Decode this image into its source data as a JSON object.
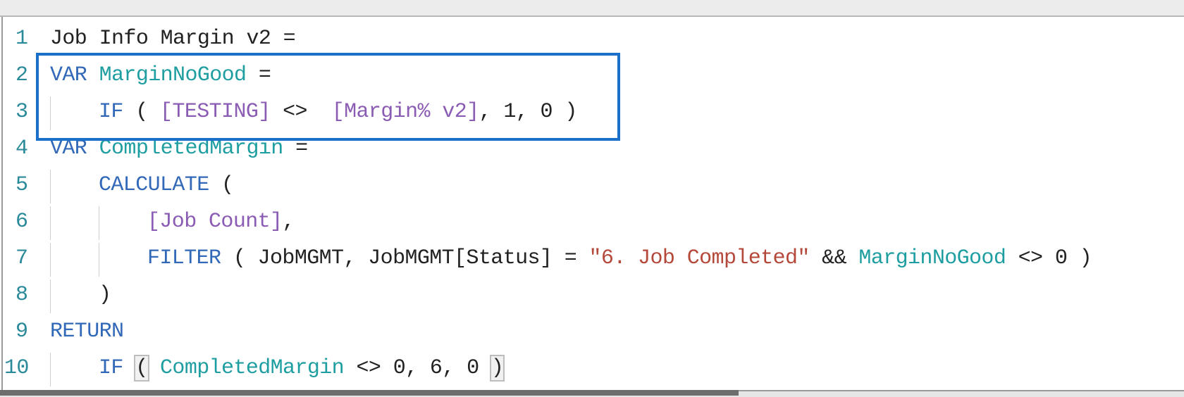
{
  "editor": {
    "lines": [
      {
        "number": "1",
        "indent": 0,
        "tokens": [
          {
            "t": "Job Info Margin v2 =",
            "c": "plain"
          }
        ]
      },
      {
        "number": "2",
        "indent": 0,
        "tokens": [
          {
            "t": "VAR ",
            "c": "kw"
          },
          {
            "t": "MarginNoGood",
            "c": "var"
          },
          {
            "t": " =",
            "c": "plain"
          }
        ]
      },
      {
        "number": "3",
        "indent": 1,
        "tokens": [
          {
            "t": "IF",
            "c": "kw"
          },
          {
            "t": " ( ",
            "c": "plain"
          },
          {
            "t": "[TESTING]",
            "c": "meas"
          },
          {
            "t": " <>  ",
            "c": "plain"
          },
          {
            "t": "[Margin% v2]",
            "c": "meas"
          },
          {
            "t": ", 1, 0 )",
            "c": "plain"
          }
        ]
      },
      {
        "number": "4",
        "indent": 0,
        "tokens": [
          {
            "t": "VAR ",
            "c": "kw"
          },
          {
            "t": "CompletedMargin",
            "c": "var"
          },
          {
            "t": " =",
            "c": "plain"
          }
        ]
      },
      {
        "number": "5",
        "indent": 1,
        "tokens": [
          {
            "t": "CALCULATE",
            "c": "kw"
          },
          {
            "t": " (",
            "c": "plain"
          }
        ]
      },
      {
        "number": "6",
        "indent": 2,
        "tokens": [
          {
            "t": "[Job Count]",
            "c": "meas"
          },
          {
            "t": ",",
            "c": "plain"
          }
        ]
      },
      {
        "number": "7",
        "indent": 2,
        "tokens": [
          {
            "t": "FILTER",
            "c": "kw"
          },
          {
            "t": " ( JobMGMT, JobMGMT[Status] = ",
            "c": "plain"
          },
          {
            "t": "\"6. Job Completed\"",
            "c": "str"
          },
          {
            "t": " && ",
            "c": "plain"
          },
          {
            "t": "MarginNoGood",
            "c": "var"
          },
          {
            "t": " <> 0 )",
            "c": "plain"
          }
        ]
      },
      {
        "number": "8",
        "indent": 1,
        "tokens": [
          {
            "t": ")",
            "c": "plain"
          }
        ]
      },
      {
        "number": "9",
        "indent": 0,
        "tokens": [
          {
            "t": "RETURN",
            "c": "kw"
          }
        ]
      },
      {
        "number": "10",
        "indent": 1,
        "tokens": [
          {
            "t": "IF",
            "c": "kw"
          },
          {
            "t": " ",
            "c": "plain"
          },
          {
            "t": "(",
            "c": "plain brk"
          },
          {
            "t": " ",
            "c": "plain"
          },
          {
            "t": "CompletedMargin",
            "c": "var"
          },
          {
            "t": " <> 0, 6, 0 ",
            "c": "plain"
          },
          {
            "t": ")",
            "c": "plain brk"
          }
        ]
      }
    ],
    "highlight_color": "#1a6fc9",
    "highlighted_lines": [
      "2",
      "3"
    ]
  }
}
